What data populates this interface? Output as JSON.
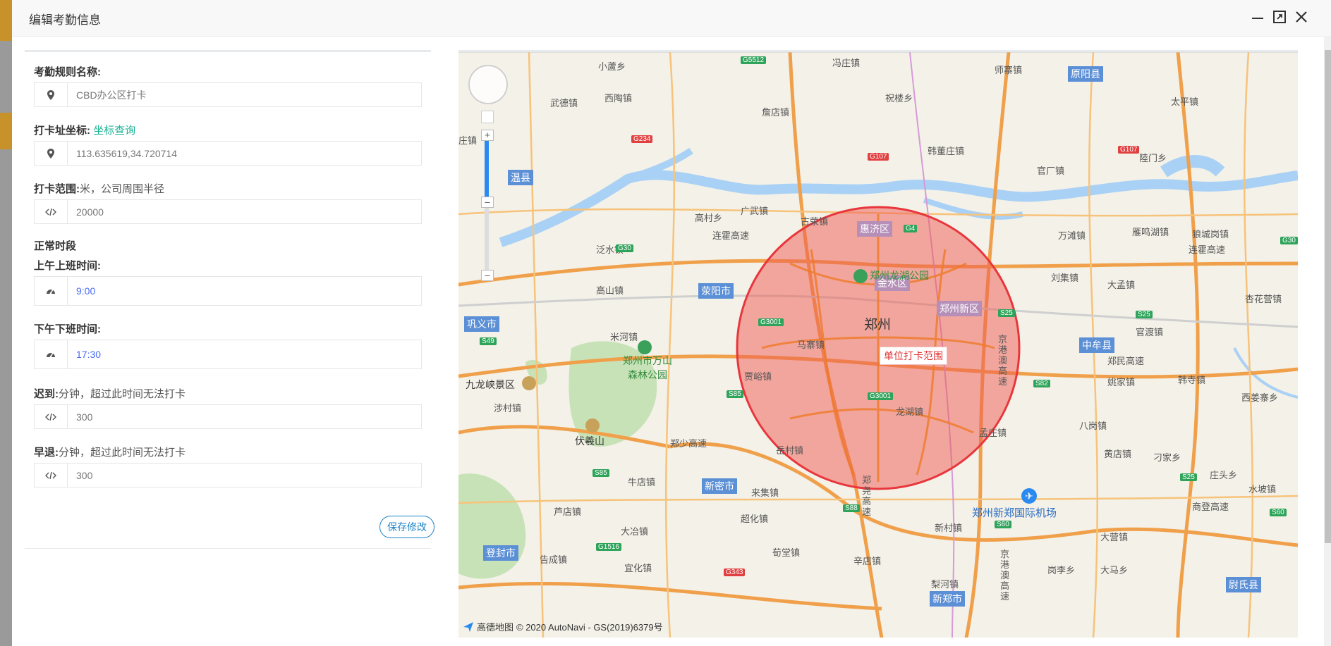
{
  "dialog": {
    "title": "编辑考勤信息"
  },
  "form": {
    "rule_name": {
      "label": "考勤规则名称:",
      "value": "CBD办公区打卡"
    },
    "coords": {
      "label": "打卡址坐标:",
      "link": "坐标查询",
      "value": "113.635619,34.720714"
    },
    "range": {
      "label": "打卡范围:",
      "hint": "米，公司周围半径",
      "value": "20000"
    },
    "section_title": "正常时段",
    "morning": {
      "label": "上午上班时间:",
      "value": "9:00"
    },
    "afternoon": {
      "label": "下午下班时间:",
      "value": "17:30"
    },
    "late": {
      "label": "迟到:",
      "hint": "分钟，超过此时间无法打卡",
      "value": "300"
    },
    "early": {
      "label": "早退:",
      "hint": "分钟，超过此时间无法打卡",
      "value": "300"
    },
    "save_label": "保存修改"
  },
  "map": {
    "center_label": "郑州",
    "circle_label": "单位打卡范围",
    "airport": "郑州新郑国际机场",
    "footer_brand": "高德地图",
    "footer_copyright": "© 2020 AutoNavi - GS(2019)6379号",
    "city_tags": [
      "原阳县",
      "温县",
      "荥阳市",
      "巩义市",
      "中牟县",
      "新密市",
      "登封市",
      "新郑市",
      "尉氏县"
    ],
    "district_tags": [
      "惠济区",
      "金水区",
      "郑州新区"
    ],
    "place_labels": [
      "小蘆乡",
      "武德镇",
      "西陶镇",
      "冯庄镇",
      "师寨镇",
      "太平镇",
      "庄镇",
      "詹店镇",
      "祝楼乡",
      "韩董庄镇",
      "官厂镇",
      "陸门乡",
      "高村乡",
      "广武镇",
      "古荥镇",
      "连霍高速",
      "泛水镇",
      "万滩镇",
      "雁鸣湖镇",
      "狼城岗镇",
      "连霍高速",
      "高山镇",
      "刘集镇",
      "大孟镇",
      "杏花营镇",
      "米河镇",
      "马寨镇",
      "官渡镇",
      "贾峪镇",
      "姚家镇",
      "韩寺镇",
      "涉村镇",
      "西姜寨乡",
      "龙湖镇",
      "孟庄镇",
      "八岗镇",
      "郑少高速",
      "岳村镇",
      "黄店镇",
      "刁家乡",
      "牛店镇",
      "庄头乡",
      "芦店镇",
      "来集镇",
      "水坡镇",
      "大冶镇",
      "超化镇",
      "新村镇",
      "商登高速",
      "大营镇",
      "荀堂镇",
      "辛店镇",
      "告成镇",
      "宜化镇",
      "岗李乡",
      "大马乡",
      "梨河镇",
      "郑民高速"
    ],
    "green_labels": [
      "郑州龙湖公园",
      "郑州市万山森林公园",
      "九龙峡景区",
      "伏羲山"
    ],
    "road_badges_green": [
      "G5512",
      "G30",
      "G4",
      "G3001",
      "G3001",
      "S85",
      "S82",
      "S25",
      "S25",
      "S60",
      "S88",
      "S60",
      "G1516",
      "S85",
      "S49",
      "S25",
      "G30"
    ],
    "road_badges_red": [
      "G234",
      "G107",
      "G107",
      "G343"
    ],
    "vertical_road_labels": [
      "京港澳高速",
      "京港澳高速",
      "郑尧高速"
    ]
  }
}
